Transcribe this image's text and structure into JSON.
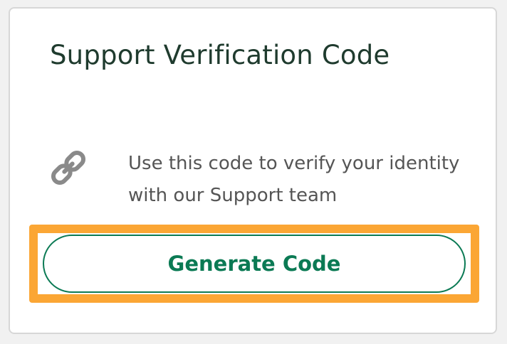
{
  "card": {
    "title": "Support Verification Code",
    "description": "Use this code to verify your identity with our Support team",
    "icon": "link-icon",
    "button_label": "Generate Code"
  },
  "colors": {
    "title": "#1f3b2e",
    "text": "#555555",
    "accent": "#0b7a54",
    "highlight": "#fba634",
    "icon": "#8a8a8a"
  }
}
